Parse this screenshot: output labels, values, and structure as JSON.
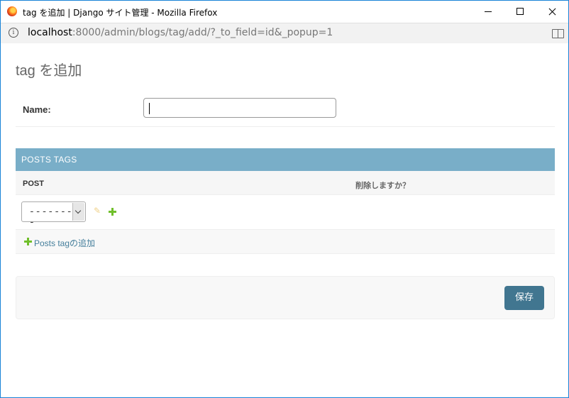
{
  "browser": {
    "window_title": "tag を追加 | Django サイト管理 - Mozilla Firefox",
    "url_host": "localhost",
    "url_rest": ":8000/admin/blogs/tag/add/?_to_field=id&_popup=1"
  },
  "page": {
    "title": "tag を追加",
    "name_label": "Name:",
    "name_value": ""
  },
  "inline": {
    "header": "POSTS TAGS",
    "col_post": "POST",
    "col_delete": "削除しますか？",
    "row_select_value": "---------",
    "add_link": "Posts tagの追加"
  },
  "actions": {
    "save_label": "保存"
  },
  "colors": {
    "header_bg": "#79aec8",
    "button_bg": "#417690",
    "link": "#447e9b",
    "add_icon": "#70bf2b"
  }
}
